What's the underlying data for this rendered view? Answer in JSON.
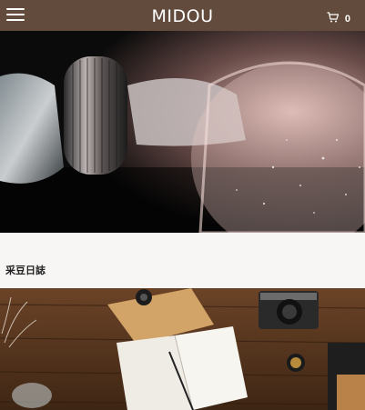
{
  "header": {
    "logo": "MIDOU",
    "menu_icon": "hamburger-menu-icon",
    "cart_icon": "shopping-cart-icon",
    "cart_count": "0",
    "background": "#624b3c"
  },
  "section": {
    "title": "采豆日誌"
  }
}
